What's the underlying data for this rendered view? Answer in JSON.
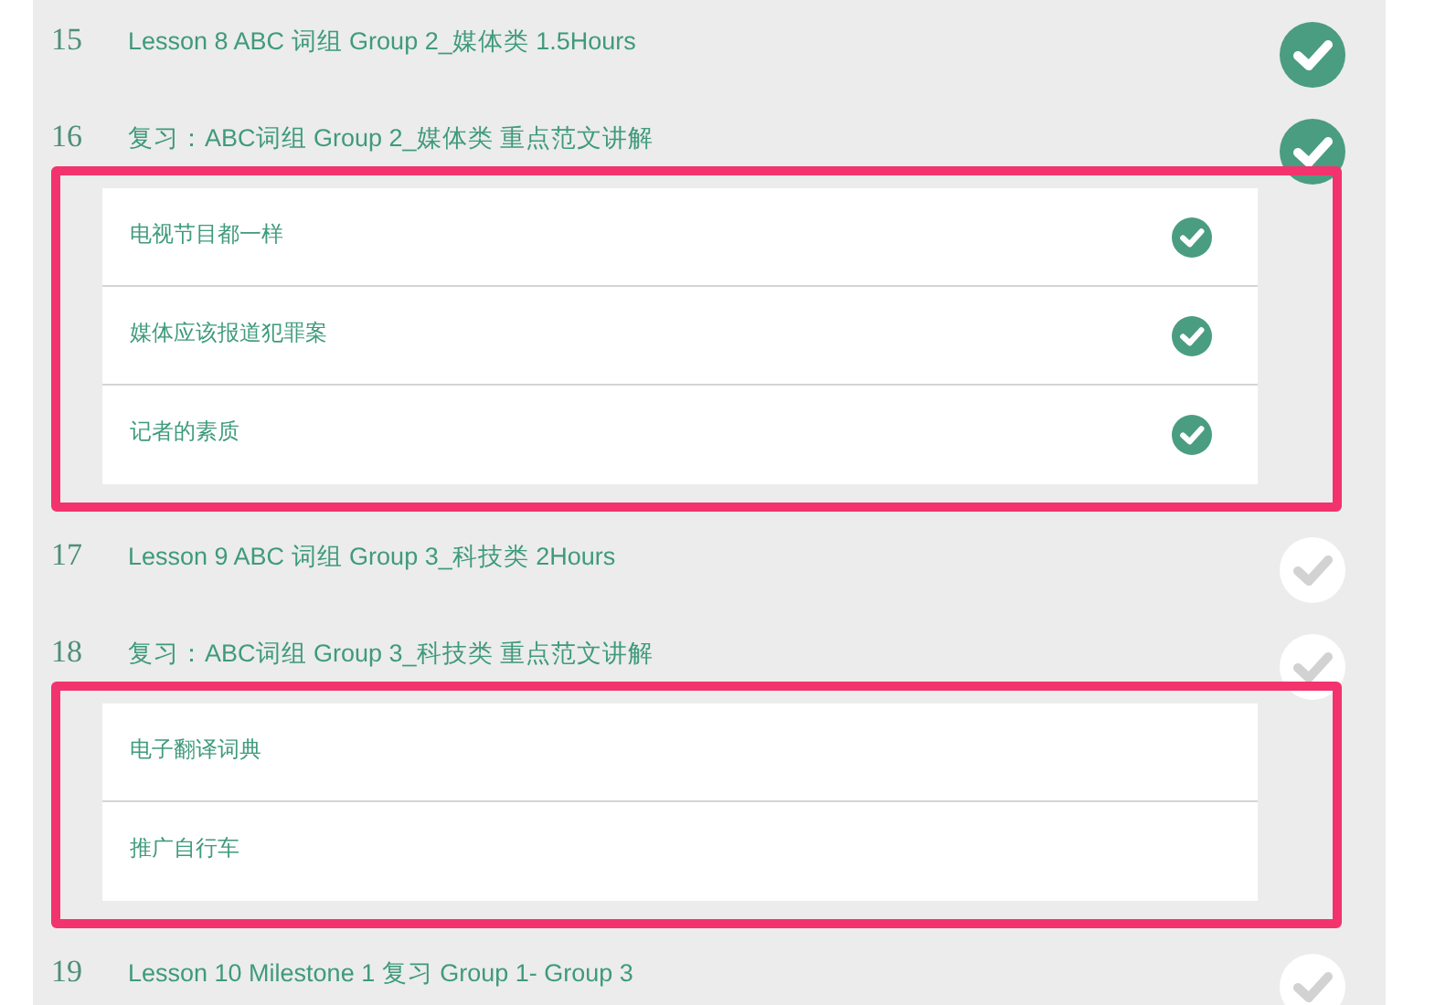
{
  "lessons": [
    {
      "number": "15",
      "title": "Lesson 8 ABC 词组 Group 2_媒体类 1.5Hours",
      "done": true,
      "highlighted": false
    },
    {
      "number": "16",
      "title": "复习：ABC词组 Group 2_媒体类 重点范文讲解",
      "done": true,
      "highlighted": true,
      "children": [
        {
          "title": "电视节目都一样",
          "done": true
        },
        {
          "title": "媒体应该报道犯罪案",
          "done": true
        },
        {
          "title": "记者的素质",
          "done": true
        }
      ]
    },
    {
      "number": "17",
      "title": "Lesson 9 ABC 词组 Group 3_科技类 2Hours",
      "done": false,
      "highlighted": false
    },
    {
      "number": "18",
      "title": "复习：ABC词组 Group 3_科技类 重点范文讲解",
      "done": false,
      "highlighted": true,
      "children": [
        {
          "title": "电子翻译词典",
          "done": false
        },
        {
          "title": "推广自行车",
          "done": false
        }
      ]
    },
    {
      "number": "19",
      "title": "Lesson 10 Milestone 1 复习 Group 1- Group 3",
      "done": false,
      "highlighted": false
    }
  ]
}
